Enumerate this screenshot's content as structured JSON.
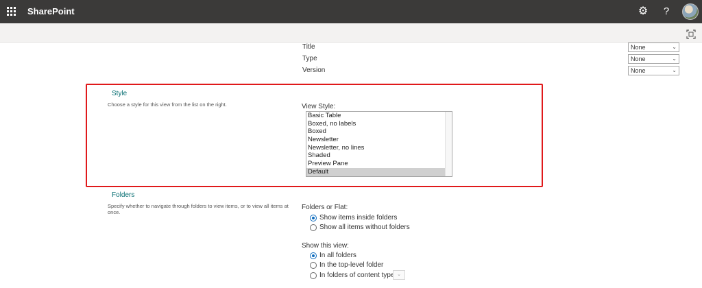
{
  "header": {
    "app_name": "SharePoint"
  },
  "top_fields": [
    {
      "label": "Title",
      "value": "None"
    },
    {
      "label": "Type",
      "value": "None"
    },
    {
      "label": "Version",
      "value": "None"
    }
  ],
  "style_section": {
    "title": "Style",
    "description": "Choose a style for this view from the list on the right.",
    "field_label": "View Style:",
    "options": [
      "Basic Table",
      "Boxed, no labels",
      "Boxed",
      "Newsletter",
      "Newsletter, no lines",
      "Shaded",
      "Preview Pane",
      "Default"
    ],
    "selected": "Default"
  },
  "folders_section": {
    "title": "Folders",
    "description_line1": "Specify whether to navigate through folders to view items, or to view all items at",
    "description_line2": "once.",
    "folders_label": "Folders or Flat:",
    "folder_options": [
      "Show items inside folders",
      "Show all items without folders"
    ],
    "show_view_label": "Show this view:",
    "view_options": [
      "In all folders",
      "In the top-level folder",
      "In folders of content type:"
    ]
  },
  "colors": {
    "topbar": "#3b3a39",
    "accent": "#036c70",
    "highlight": "#e0191b",
    "radio": "#0f6cbd"
  }
}
